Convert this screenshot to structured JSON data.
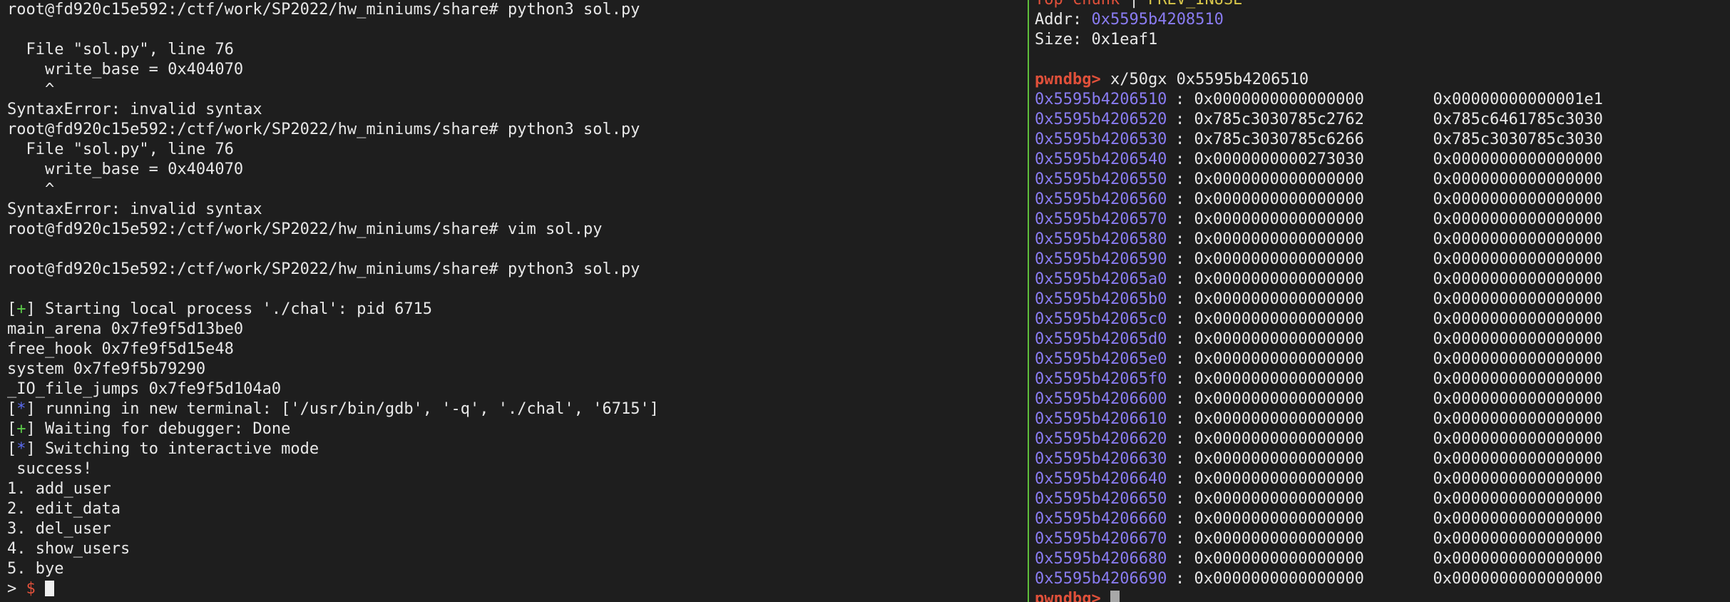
{
  "left": {
    "prompt": "root@fd920c15e592:/ctf/work/SP2022/hw_miniums/share#",
    "cmd1": "python3 sol.py",
    "err1_file": "  File \"sol.py\", line 76",
    "err_code": "    write_base = 0x404070",
    "caret": "    ^",
    "syntax_error": "SyntaxError: invalid syntax",
    "cmd2": "python3 sol.py",
    "err2_file": "  File \"sol.py\", line 76",
    "cmd3": "vim sol.py",
    "cmd4": "python3 sol.py",
    "plus_marker": "+",
    "star_marker": "*",
    "starting": "Starting local process './chal': pid 6715",
    "main_arena": "main_arena 0x7fe9f5d13be0",
    "free_hook": "free_hook 0x7fe9f5d15e48",
    "system": "system 0x7fe9f5b79290",
    "io_file_jumps": "_IO_file_jumps 0x7fe9f5d104a0",
    "running_new_terminal": "running in new terminal: ['/usr/bin/gdb', '-q', './chal', '6715']",
    "waiting_debugger": "Waiting for debugger: Done",
    "switching": "Switching to interactive mode",
    "success": " success!",
    "menu": [
      "1. add_user",
      "2. edit_data",
      "3. del_user",
      "4. show_users",
      "5. bye"
    ],
    "final_gt": "> ",
    "final_dollar": "$ "
  },
  "right": {
    "top_chunk": "Top chunk",
    "sep": " | ",
    "prev_inuse": "PREV_INUSE",
    "addr_label": "Addr: ",
    "addr_value": "0x5595b4208510",
    "size_line": "Size: 0x1eaf1",
    "pwndbg_prompt": "pwndbg>",
    "x_cmd": " x/50gx 0x5595b4206510",
    "memory_rows": [
      {
        "addr": "0x5595b4206510",
        "v1": "0x0000000000000000",
        "v2": "0x00000000000001e1"
      },
      {
        "addr": "0x5595b4206520",
        "v1": "0x785c3030785c2762",
        "v2": "0x785c6461785c3030"
      },
      {
        "addr": "0x5595b4206530",
        "v1": "0x785c3030785c6266",
        "v2": "0x785c3030785c3030"
      },
      {
        "addr": "0x5595b4206540",
        "v1": "0x0000000000273030",
        "v2": "0x0000000000000000"
      },
      {
        "addr": "0x5595b4206550",
        "v1": "0x0000000000000000",
        "v2": "0x0000000000000000"
      },
      {
        "addr": "0x5595b4206560",
        "v1": "0x0000000000000000",
        "v2": "0x0000000000000000"
      },
      {
        "addr": "0x5595b4206570",
        "v1": "0x0000000000000000",
        "v2": "0x0000000000000000"
      },
      {
        "addr": "0x5595b4206580",
        "v1": "0x0000000000000000",
        "v2": "0x0000000000000000"
      },
      {
        "addr": "0x5595b4206590",
        "v1": "0x0000000000000000",
        "v2": "0x0000000000000000"
      },
      {
        "addr": "0x5595b42065a0",
        "v1": "0x0000000000000000",
        "v2": "0x0000000000000000"
      },
      {
        "addr": "0x5595b42065b0",
        "v1": "0x0000000000000000",
        "v2": "0x0000000000000000"
      },
      {
        "addr": "0x5595b42065c0",
        "v1": "0x0000000000000000",
        "v2": "0x0000000000000000"
      },
      {
        "addr": "0x5595b42065d0",
        "v1": "0x0000000000000000",
        "v2": "0x0000000000000000"
      },
      {
        "addr": "0x5595b42065e0",
        "v1": "0x0000000000000000",
        "v2": "0x0000000000000000"
      },
      {
        "addr": "0x5595b42065f0",
        "v1": "0x0000000000000000",
        "v2": "0x0000000000000000"
      },
      {
        "addr": "0x5595b4206600",
        "v1": "0x0000000000000000",
        "v2": "0x0000000000000000"
      },
      {
        "addr": "0x5595b4206610",
        "v1": "0x0000000000000000",
        "v2": "0x0000000000000000"
      },
      {
        "addr": "0x5595b4206620",
        "v1": "0x0000000000000000",
        "v2": "0x0000000000000000"
      },
      {
        "addr": "0x5595b4206630",
        "v1": "0x0000000000000000",
        "v2": "0x0000000000000000"
      },
      {
        "addr": "0x5595b4206640",
        "v1": "0x0000000000000000",
        "v2": "0x0000000000000000"
      },
      {
        "addr": "0x5595b4206650",
        "v1": "0x0000000000000000",
        "v2": "0x0000000000000000"
      },
      {
        "addr": "0x5595b4206660",
        "v1": "0x0000000000000000",
        "v2": "0x0000000000000000"
      },
      {
        "addr": "0x5595b4206670",
        "v1": "0x0000000000000000",
        "v2": "0x0000000000000000"
      },
      {
        "addr": "0x5595b4206680",
        "v1": "0x0000000000000000",
        "v2": "0x0000000000000000"
      },
      {
        "addr": "0x5595b4206690",
        "v1": "0x0000000000000000",
        "v2": "0x0000000000000000"
      }
    ],
    "final_prompt": "pwndbg> "
  }
}
